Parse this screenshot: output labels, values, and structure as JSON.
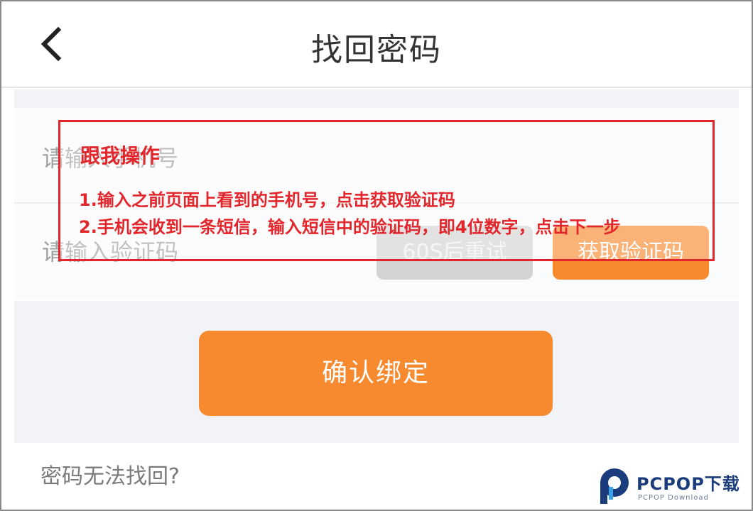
{
  "header": {
    "back_icon": "chevron-left-icon",
    "title": "找回密码"
  },
  "form": {
    "phone_placeholder": "请输入手机号",
    "code_placeholder": "请输入验证码",
    "retry_label": "60S后重试",
    "get_code_label": "获取验证码"
  },
  "confirm_label": "确认绑定",
  "cant_recover_link": "密码无法找回?",
  "annotation": {
    "title": "跟我操作",
    "step1": "1.输入之前页面上看到的手机号，点击获取验证码",
    "step2": "2.手机会收到一条短信，输入短信中的验证码，即4位数字，点击下一步"
  },
  "watermark": {
    "brand": "PCPOP下载",
    "sub": "PCPOP Download"
  },
  "colors": {
    "accent": "#f7892f",
    "annotation": "#e2262b",
    "disabled": "#d3d3d3",
    "watermark": "#1a3c7c"
  }
}
